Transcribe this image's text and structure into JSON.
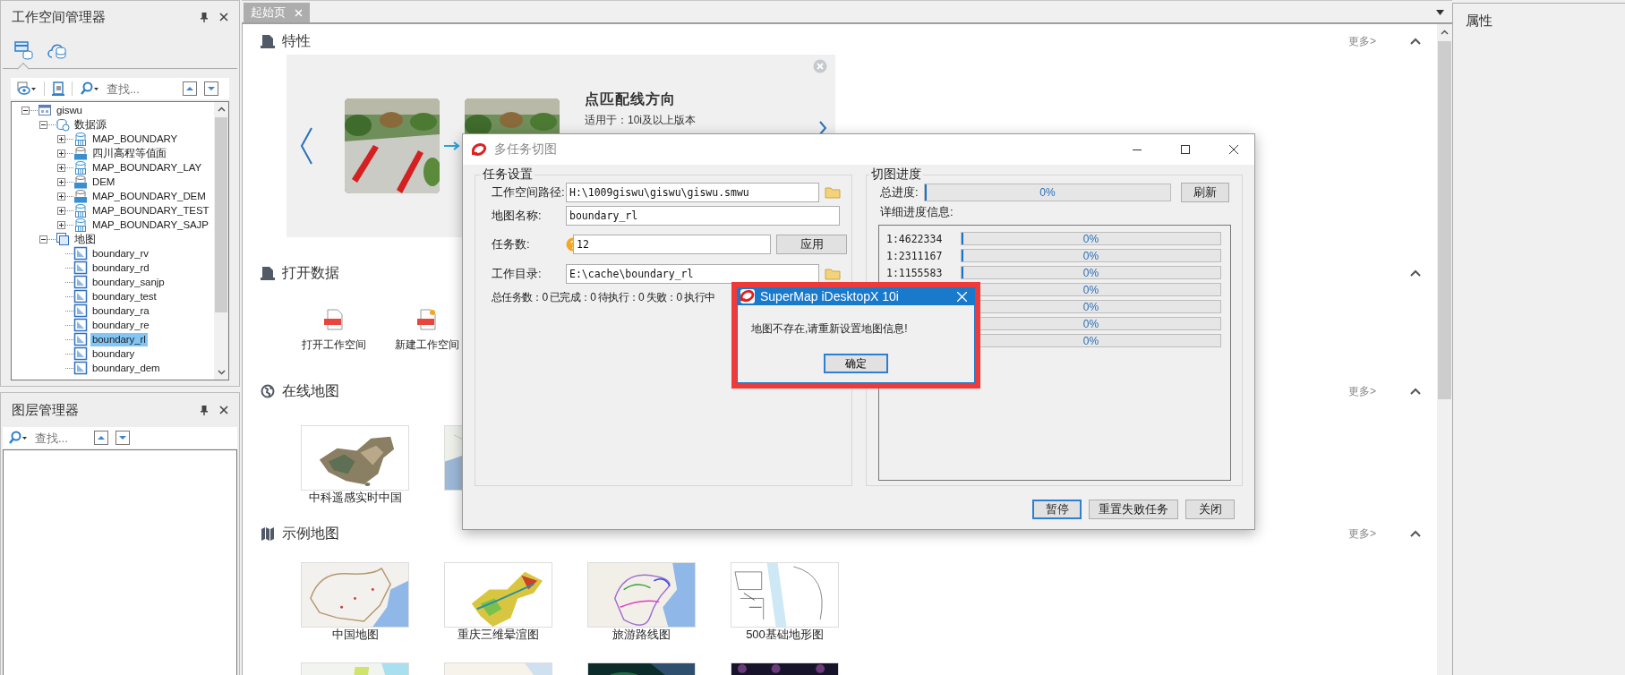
{
  "workspace_panel": {
    "title": "工作空间管理器",
    "view_tabs": [
      {
        "kind": "workspace",
        "selected": true
      },
      {
        "kind": "online",
        "selected": false
      }
    ],
    "search": {
      "placeholder": "查找..."
    },
    "tree": [
      {
        "label": "giswu",
        "kind": "workspace",
        "expanded": true,
        "selected": false,
        "children": [
          {
            "label": "数据源",
            "kind": "datasources",
            "expanded": true,
            "selected": false,
            "children": [
              {
                "label": "MAP_BOUNDARY",
                "kind": "udb",
                "expanded": false,
                "selected": false
              },
              {
                "label": "四川高程等值面",
                "kind": "udx",
                "expanded": false,
                "selected": false
              },
              {
                "label": "MAP_BOUNDARY_LAY",
                "kind": "udb",
                "expanded": false,
                "selected": false
              },
              {
                "label": "DEM",
                "kind": "udx",
                "expanded": false,
                "selected": false
              },
              {
                "label": "MAP_BOUNDARY_DEM",
                "kind": "udx",
                "expanded": false,
                "selected": false
              },
              {
                "label": "MAP_BOUNDARY_TEST",
                "kind": "udb",
                "expanded": false,
                "selected": false
              },
              {
                "label": "MAP_BOUNDARY_SAJP",
                "kind": "udb",
                "expanded": false,
                "selected": false
              }
            ]
          },
          {
            "label": "地图",
            "kind": "maps",
            "expanded": true,
            "selected": false,
            "children": [
              {
                "label": "boundary_rv",
                "kind": "map",
                "selected": false
              },
              {
                "label": "boundary_rd",
                "kind": "map",
                "selected": false
              },
              {
                "label": "boundary_sanjp",
                "kind": "map",
                "selected": false
              },
              {
                "label": "boundary_test",
                "kind": "map",
                "selected": false
              },
              {
                "label": "boundary_ra",
                "kind": "map",
                "selected": false
              },
              {
                "label": "boundary_re",
                "kind": "map",
                "selected": false
              },
              {
                "label": "boundary_rl",
                "kind": "map",
                "selected": true
              },
              {
                "label": "boundary",
                "kind": "map",
                "selected": false
              },
              {
                "label": "boundary_dem",
                "kind": "map",
                "selected": false
              }
            ]
          }
        ]
      }
    ]
  },
  "layer_panel": {
    "title": "图层管理器",
    "search": {
      "placeholder": "查找..."
    }
  },
  "document_tabs": [
    {
      "label": "起始页",
      "selected": true
    }
  ],
  "start_page": {
    "sections": [
      {
        "kind": "feature",
        "title": "特性",
        "more": "更多>",
        "card": {
          "title": "点匹配线方向",
          "version": "适用于：10i及以上版本"
        }
      },
      {
        "kind": "actions",
        "title": "打开数据",
        "items": [
          {
            "kind": "open",
            "label": "打开工作空间"
          },
          {
            "kind": "new",
            "label": "新建工作空间"
          }
        ]
      },
      {
        "kind": "online",
        "title": "在线地图",
        "more": "更多>",
        "items": [
          {
            "kind": "picture",
            "label": "中科遥感实时中国"
          },
          {
            "kind": "picture"
          }
        ]
      },
      {
        "kind": "samples",
        "title": "示例地图",
        "more": "更多>",
        "items": [
          {
            "kind": "picture",
            "label": "中国地图"
          },
          {
            "kind": "picture",
            "label": "重庆三维晕渲图"
          },
          {
            "kind": "picture",
            "label": "旅游路线图"
          },
          {
            "kind": "picture",
            "label": "500基础地形图"
          },
          {
            "kind": "picture"
          },
          {
            "kind": "picture"
          },
          {
            "kind": "picture"
          },
          {
            "kind": "picture"
          }
        ]
      }
    ]
  },
  "properties_panel": {
    "title": "属性"
  },
  "tile_dialog": {
    "title": "多任务切图",
    "settings": {
      "title": "任务设置",
      "fields": [
        {
          "kind": "path",
          "label": "工作空间路径:",
          "value": "H:\\1009giswu\\giswu\\giswu.smwu"
        },
        {
          "kind": "text",
          "label": "地图名称:",
          "value": "boundary_rl"
        },
        {
          "kind": "count",
          "label": "任务数:",
          "value": "12",
          "button": "应用"
        },
        {
          "kind": "path",
          "label": "工作目录:",
          "value": "E:\\cache\\boundary_rl"
        }
      ],
      "summary": "总任务数：0 已完成：0 待执行：0 失败：0 执行中"
    },
    "progress": {
      "title": "切图进度",
      "total_label": "总进度:",
      "total": {
        "level": 0,
        "reading": "0%"
      },
      "refresh": "刷新",
      "detail_label": "详细进度信息:",
      "rows": [
        {
          "scale": "1:4622334",
          "level": 0,
          "reading": "0%"
        },
        {
          "scale": "1:2311167",
          "level": 0,
          "reading": "0%"
        },
        {
          "scale": "1:1155583",
          "level": 0,
          "reading": "0%"
        },
        {
          "level": 0,
          "reading": "0%"
        },
        {
          "level": 0,
          "reading": "0%"
        },
        {
          "level": 0,
          "reading": "0%"
        },
        {
          "level": 0,
          "reading": "0%"
        }
      ]
    },
    "buttons": [
      {
        "label": "暂停",
        "focused": true
      },
      {
        "label": "重置失败任务",
        "focused": false
      },
      {
        "label": "关闭",
        "focused": false
      }
    ]
  },
  "message_box": {
    "title": "SuperMap iDesktopX 10i",
    "message": "地图不存在,请重新设置地图信息!",
    "button": "确定"
  }
}
